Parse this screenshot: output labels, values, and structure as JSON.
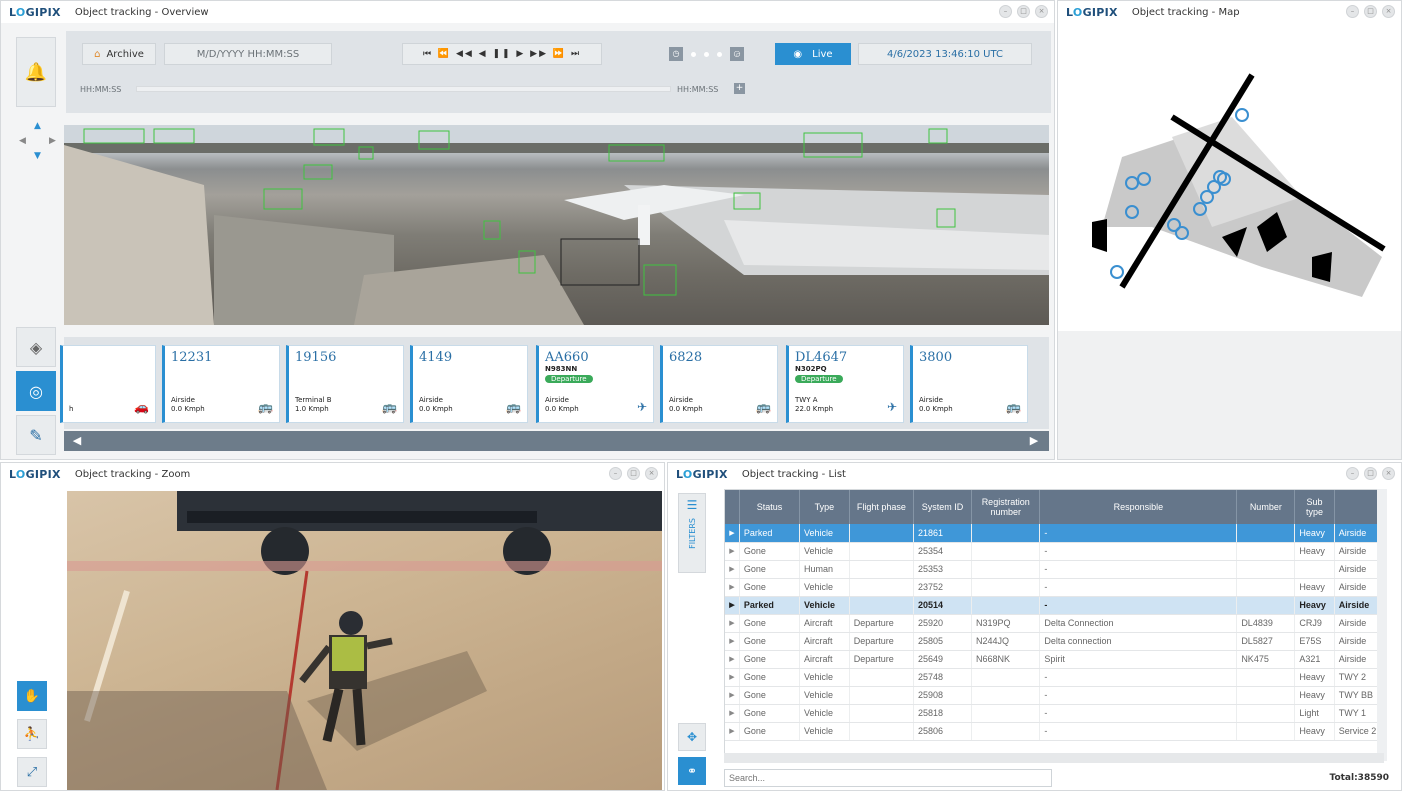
{
  "brand": {
    "name_prefix": "L",
    "name_o": "O",
    "name_suffix": "GIPIX"
  },
  "windows": {
    "overview": {
      "title": "Object tracking - Overview"
    },
    "map": {
      "title": "Object tracking - Map"
    },
    "zoom": {
      "title": "Object tracking - Zoom"
    },
    "list": {
      "title": "Object tracking - List"
    }
  },
  "window_controls": {
    "minimize": "–",
    "maximize": "□",
    "close": "×"
  },
  "toolbar": {
    "archive_label": "Archive",
    "datetime_placeholder": "M/D/YYYY HH:MM:SS",
    "playback_icons": "⏮ ⏪ ◀◀ ◀ ❚❚ ▶ ▶▶ ⏩ ⏭",
    "live_label": "Live",
    "live_datetime": "4/6/2023 13:46:10 UTC",
    "timeline_start": "HH:MM:SS",
    "timeline_end": "HH:MM:SS"
  },
  "cards": [
    {
      "id": "",
      "reg": "",
      "badge": "",
      "location": "",
      "speed": "h",
      "icon": "🚗"
    },
    {
      "id": "12231",
      "reg": "",
      "badge": "",
      "location": "Airside",
      "speed": "0.0 Kmph",
      "icon": "🚌"
    },
    {
      "id": "19156",
      "reg": "",
      "badge": "",
      "location": "Terminal B",
      "speed": "1.0 Kmph",
      "icon": "🚌"
    },
    {
      "id": "4149",
      "reg": "",
      "badge": "",
      "location": "Airside",
      "speed": "0.0 Kmph",
      "icon": "🚌"
    },
    {
      "id": "AA660",
      "reg": "N983NN",
      "badge": "Departure",
      "location": "Airside",
      "speed": "0.0 Kmph",
      "icon": "✈"
    },
    {
      "id": "6828",
      "reg": "",
      "badge": "",
      "location": "Airside",
      "speed": "0.0 Kmph",
      "icon": "🚌"
    },
    {
      "id": "DL4647",
      "reg": "N302PQ",
      "badge": "Departure",
      "location": "TWY A",
      "speed": "22.0 Kmph",
      "icon": "✈"
    },
    {
      "id": "3800",
      "reg": "",
      "badge": "",
      "location": "Airside",
      "speed": "0.0 Kmph",
      "icon": "🚌"
    }
  ],
  "list": {
    "filters_label": "FILTERS",
    "columns": [
      "Status",
      "Type",
      "Flight phase",
      "System ID",
      "Registration number",
      "Responsible",
      "Number",
      "Sub type",
      ""
    ],
    "rows": [
      {
        "status": "Parked",
        "type": "Vehicle",
        "phase": "",
        "sysid": "21861",
        "reg": "",
        "resp": "-",
        "number": "",
        "sub": "Heavy",
        "area": "Airside",
        "state": "selected"
      },
      {
        "status": "Gone",
        "type": "Vehicle",
        "phase": "",
        "sysid": "25354",
        "reg": "",
        "resp": "-",
        "number": "",
        "sub": "Heavy",
        "area": "Airside",
        "state": ""
      },
      {
        "status": "Gone",
        "type": "Human",
        "phase": "",
        "sysid": "25353",
        "reg": "",
        "resp": "-",
        "number": "",
        "sub": "",
        "area": "Airside",
        "state": ""
      },
      {
        "status": "Gone",
        "type": "Vehicle",
        "phase": "",
        "sysid": "23752",
        "reg": "",
        "resp": "-",
        "number": "",
        "sub": "Heavy",
        "area": "Airside",
        "state": ""
      },
      {
        "status": "Parked",
        "type": "Vehicle",
        "phase": "",
        "sysid": "20514",
        "reg": "",
        "resp": "-",
        "number": "",
        "sub": "Heavy",
        "area": "Airside",
        "state": "highlight"
      },
      {
        "status": "Gone",
        "type": "Aircraft",
        "phase": "Departure",
        "sysid": "25920",
        "reg": "N319PQ",
        "resp": "Delta Connection",
        "number": "DL4839",
        "sub": "CRJ9",
        "area": "Airside",
        "state": ""
      },
      {
        "status": "Gone",
        "type": "Aircraft",
        "phase": "Departure",
        "sysid": "25805",
        "reg": "N244JQ",
        "resp": "Delta connection",
        "number": "DL5827",
        "sub": "E75S",
        "area": "Airside",
        "state": ""
      },
      {
        "status": "Gone",
        "type": "Aircraft",
        "phase": "Departure",
        "sysid": "25649",
        "reg": "N668NK",
        "resp": "Spirit",
        "number": "NK475",
        "sub": "A321",
        "area": "Airside",
        "state": ""
      },
      {
        "status": "Gone",
        "type": "Vehicle",
        "phase": "",
        "sysid": "25748",
        "reg": "",
        "resp": "-",
        "number": "",
        "sub": "Heavy",
        "area": "TWY 2",
        "state": ""
      },
      {
        "status": "Gone",
        "type": "Vehicle",
        "phase": "",
        "sysid": "25908",
        "reg": "",
        "resp": "-",
        "number": "",
        "sub": "Heavy",
        "area": "TWY BB",
        "state": ""
      },
      {
        "status": "Gone",
        "type": "Vehicle",
        "phase": "",
        "sysid": "25818",
        "reg": "",
        "resp": "-",
        "number": "",
        "sub": "Light",
        "area": "TWY 1",
        "state": ""
      },
      {
        "status": "Gone",
        "type": "Vehicle",
        "phase": "",
        "sysid": "25806",
        "reg": "",
        "resp": "-",
        "number": "",
        "sub": "Heavy",
        "area": "Service 2",
        "state": ""
      }
    ],
    "search_placeholder": "Search...",
    "total_label": "Total:38590"
  },
  "colors": {
    "accent": "#2a8fd1",
    "header": "#65768a",
    "badge": "#3aaa5a"
  }
}
